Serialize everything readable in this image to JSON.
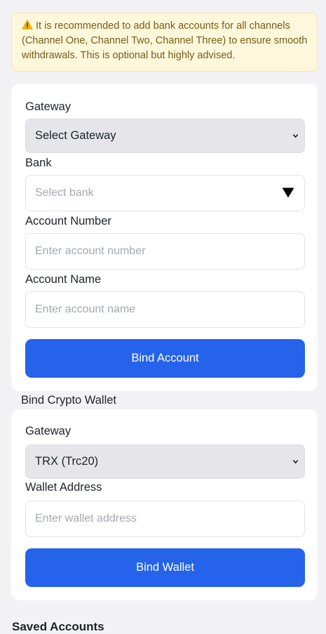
{
  "notice": {
    "icon": "warning-icon",
    "text": "It is recommended to add bank accounts for all channels (Channel One, Channel Two, Channel Three) to ensure smooth withdrawals. This is optional but highly advised."
  },
  "bank_form": {
    "gateway_label": "Gateway",
    "gateway_value": "Select Gateway",
    "bank_label": "Bank",
    "bank_placeholder": "Select bank",
    "account_number_label": "Account Number",
    "account_number_placeholder": "Enter account number",
    "account_name_label": "Account Name",
    "account_name_placeholder": "Enter account name",
    "submit_label": "Bind Account"
  },
  "crypto_section_title": "Bind Crypto Wallet",
  "crypto_form": {
    "gateway_label": "Gateway",
    "gateway_value": "TRX (Trc20)",
    "wallet_address_label": "Wallet Address",
    "wallet_address_placeholder": "Enter wallet address",
    "submit_label": "Bind Wallet"
  },
  "saved_accounts_title": "Saved Accounts",
  "colors": {
    "primary_button": "#2563eb",
    "notice_background": "#fdf8dc",
    "notice_text": "#7a5a14",
    "page_background": "#f2f2f4"
  }
}
